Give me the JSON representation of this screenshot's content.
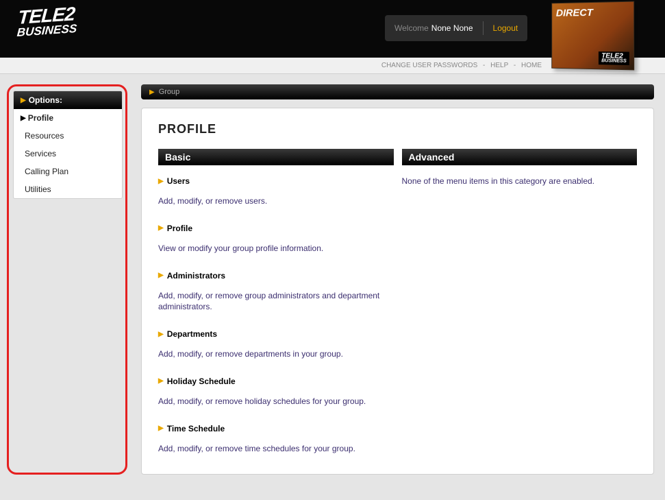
{
  "header": {
    "logo_line1": "TELE2",
    "logo_line2": "BUSINESS",
    "welcome_prefix": "Welcome",
    "user_display": "None None",
    "logout_label": "Logout",
    "promo_title": "DIRECT",
    "promo_mini_l1": "TELE2",
    "promo_mini_l2": "BUSINESS"
  },
  "subnav": {
    "items": [
      "CHANGE USER PASSWORDS",
      "HELP",
      "HOME"
    ]
  },
  "sidebar": {
    "header": "Options:",
    "items": [
      {
        "label": "Profile",
        "active": true
      },
      {
        "label": "Resources",
        "active": false
      },
      {
        "label": "Services",
        "active": false
      },
      {
        "label": "Calling Plan",
        "active": false
      },
      {
        "label": "Utilities",
        "active": false
      }
    ]
  },
  "breadcrumb": {
    "label": "Group"
  },
  "page_title": "PROFILE",
  "columns": {
    "basic": {
      "heading": "Basic",
      "sections": [
        {
          "title": "Users",
          "desc": "Add, modify, or remove users."
        },
        {
          "title": "Profile",
          "desc": "View or modify your group profile information."
        },
        {
          "title": "Administrators",
          "desc": "Add, modify, or remove group administrators and department administrators."
        },
        {
          "title": "Departments",
          "desc": "Add, modify, or remove departments in your group."
        },
        {
          "title": "Holiday Schedule",
          "desc": "Add, modify, or remove holiday schedules for your group."
        },
        {
          "title": "Time Schedule",
          "desc": "Add, modify, or remove time schedules for your group."
        }
      ]
    },
    "advanced": {
      "heading": "Advanced",
      "empty_message": "None of the menu items in this category are enabled."
    }
  }
}
